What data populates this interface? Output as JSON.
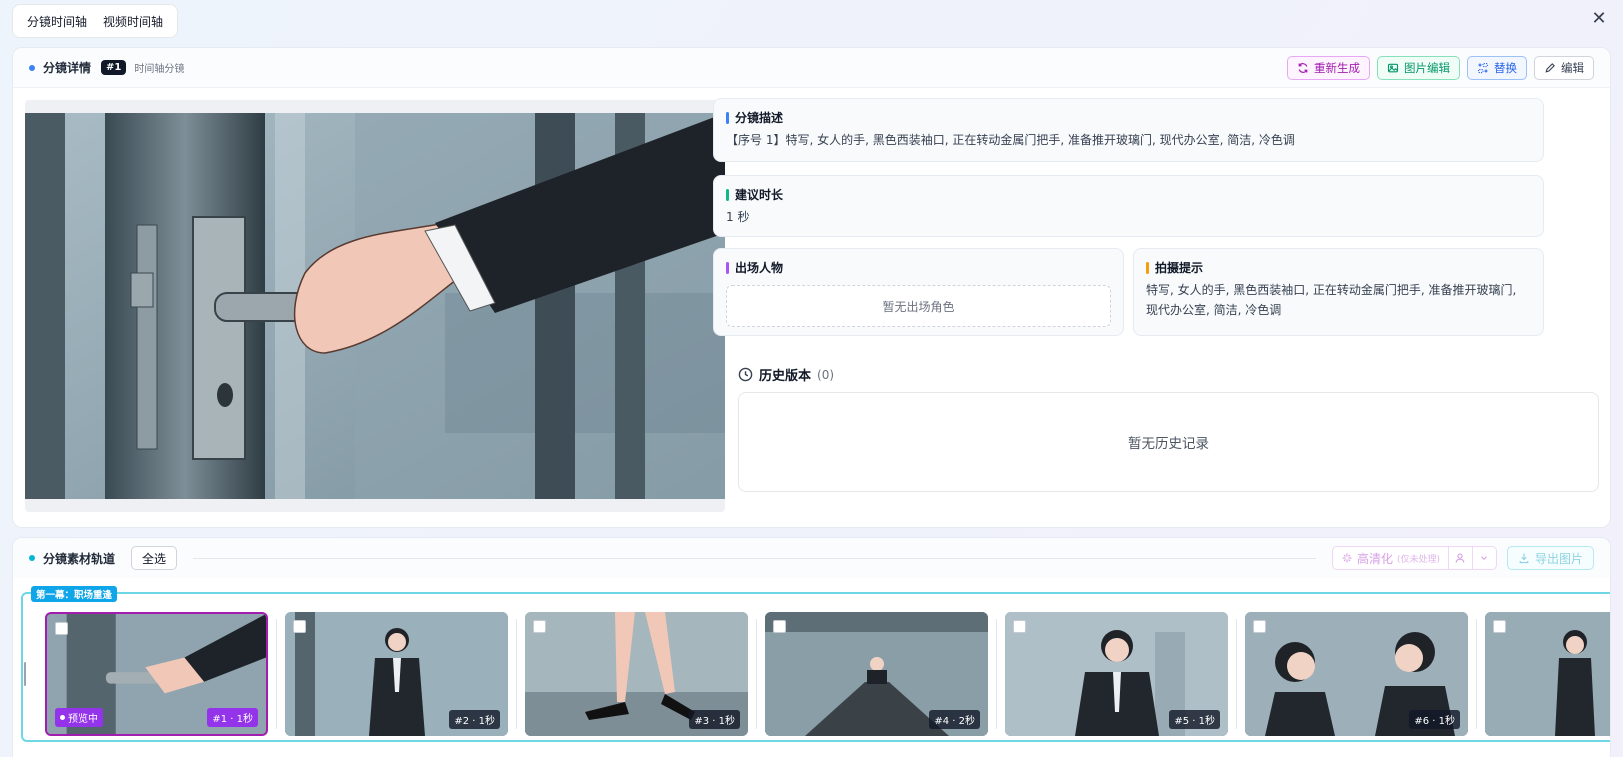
{
  "tabs": [
    "分镜时间轴",
    "视频时间轴"
  ],
  "detail": {
    "title": "分镜详情",
    "badge": "#1",
    "subtitle": "时间轴分镜",
    "actions": {
      "regenerate": "重新生成",
      "image_edit": "图片编辑",
      "replace": "替换",
      "edit": "编辑"
    },
    "description": {
      "title": "分镜描述",
      "text": "【序号 1】特写, 女人的手, 黑色西装袖口, 正在转动金属门把手, 准备推开玻璃门, 现代办公室, 简洁, 冷色调"
    },
    "duration": {
      "title": "建议时长",
      "text": "1 秒"
    },
    "characters": {
      "title": "出场人物",
      "empty": "暂无出场角色"
    },
    "tips": {
      "title": "拍摄提示",
      "text": "特写, 女人的手, 黑色西装袖口, 正在转动金属门把手, 准备推开玻璃门, 现代办公室, 简洁, 冷色调"
    },
    "history": {
      "title": "历史版本",
      "count": "(0)",
      "empty": "暂无历史记录"
    }
  },
  "track": {
    "title": "分镜素材轨道",
    "select_all": "全选",
    "hd": "高清化",
    "hd_note": "(仅未处理)",
    "export": "导出图片",
    "scene": "第一幕：职场重逢",
    "preview_label": "预览中",
    "thumbs": [
      {
        "label": "#1 · 1秒",
        "active": true
      },
      {
        "label": "#2 · 1秒",
        "active": false
      },
      {
        "label": "#3 · 1秒",
        "active": false
      },
      {
        "label": "#4 · 2秒",
        "active": false
      },
      {
        "label": "#5 · 1秒",
        "active": false
      },
      {
        "label": "#6 · 1秒",
        "active": false
      },
      {
        "label": "",
        "active": false
      }
    ]
  },
  "colors": {
    "accent_purple": "#9333ea",
    "accent_blue": "#2563eb",
    "scene_border": "#6ed7e6"
  }
}
